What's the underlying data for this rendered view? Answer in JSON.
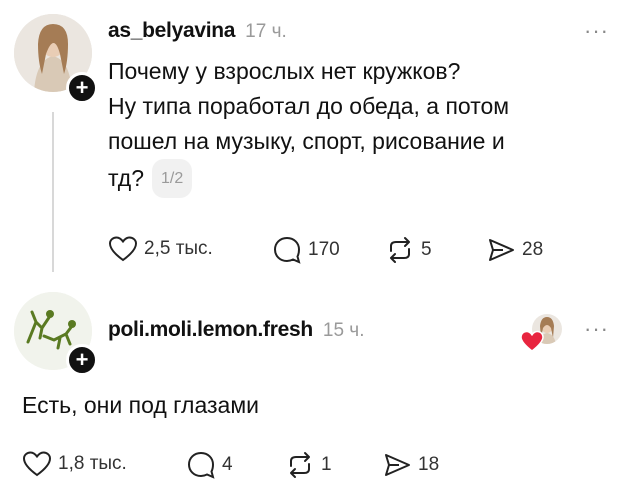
{
  "post": {
    "username": "as_belyavina",
    "time": "17 ч.",
    "more": "···",
    "lines": [
      "Почему у взрослых нет кружков?",
      "Ну типа поработал до обеда, а потом",
      "пошел на музыку, спорт, рисование и",
      "тд?"
    ],
    "pager": "1/2",
    "likes": "2,5 тыс.",
    "comments": "170",
    "reposts": "5",
    "shares": "28"
  },
  "reply": {
    "username": "poli.moli.lemon.fresh",
    "time": "15 ч.",
    "more": "···",
    "text": "Есть, они под глазами",
    "likes": "1,8 тыс.",
    "comments": "4",
    "reposts": "1",
    "shares": "18"
  },
  "colors": {
    "like_heart": "#e8253f",
    "plus_badge": "#111111"
  }
}
